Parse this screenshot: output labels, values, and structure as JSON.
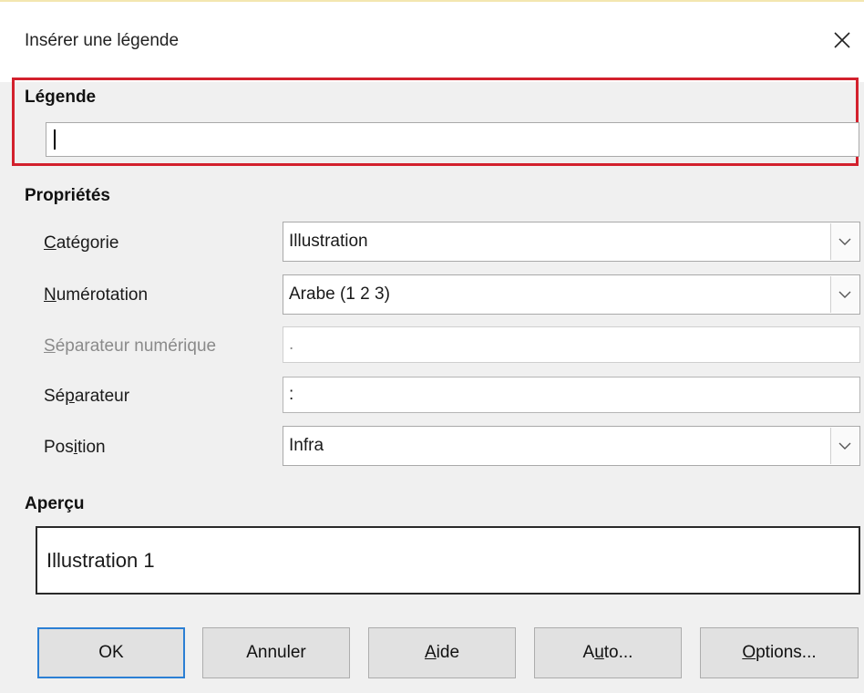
{
  "dialog": {
    "title": "Insérer une légende"
  },
  "legend": {
    "section_label": "Légende",
    "input_value": ""
  },
  "properties": {
    "section_label": "Propriétés",
    "category": {
      "label_pre": "",
      "label_key": "C",
      "label_post": "atégorie",
      "value": "Illustration"
    },
    "numbering": {
      "label_pre": "",
      "label_key": "N",
      "label_post": "umérotation",
      "value": "Arabe (1 2 3)"
    },
    "numeric_separator": {
      "label_pre": "",
      "label_key": "S",
      "label_post": "éparateur numérique",
      "value": "."
    },
    "separator": {
      "label_pre": "Sé",
      "label_key": "p",
      "label_post": "arateur",
      "value": ":"
    },
    "position": {
      "label_pre": "Pos",
      "label_key": "i",
      "label_post": "tion",
      "value": "Infra"
    }
  },
  "preview": {
    "section_label": "Aperçu",
    "text": "Illustration 1"
  },
  "buttons": {
    "ok": {
      "pre": "OK",
      "key": "",
      "post": ""
    },
    "cancel": {
      "pre": "Annuler",
      "key": "",
      "post": ""
    },
    "help": {
      "pre": "",
      "key": "A",
      "post": "ide"
    },
    "auto": {
      "pre": "A",
      "key": "u",
      "post": "to..."
    },
    "options": {
      "pre": "",
      "key": "O",
      "post": "ptions..."
    }
  },
  "colors": {
    "highlight_border": "#d3212d",
    "default_button_border": "#2b7fd4"
  }
}
